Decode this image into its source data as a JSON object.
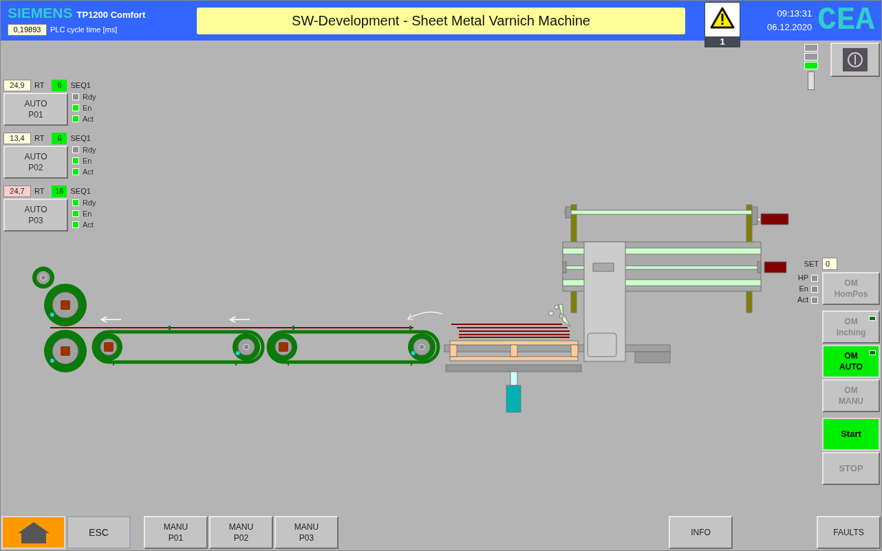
{
  "header": {
    "brand": "SIEMENS",
    "model": "TP1200 Comfort",
    "cycle_value": "0,19893",
    "cycle_label": "PLC cycle time [ms]",
    "title": "SW-Development - Sheet Metal Varnich Machine",
    "alarm_count": "1",
    "time": "09:13:31",
    "date": "06.12.2020",
    "logo": "CEA"
  },
  "status_lamps": [
    {
      "on": false
    },
    {
      "on": false
    },
    {
      "on": true
    }
  ],
  "sequences": [
    {
      "rt_value": "24,9",
      "rt_warning": false,
      "rt_label": "RT",
      "step": "6",
      "seq": "SEQ1",
      "button": [
        "AUTO",
        "P01"
      ],
      "lamps": [
        {
          "label": "Rdy",
          "on": false
        },
        {
          "label": "En",
          "on": true
        },
        {
          "label": "Act",
          "on": true
        }
      ]
    },
    {
      "rt_value": "13,4",
      "rt_warning": false,
      "rt_label": "RT",
      "step": "6",
      "seq": "SEQ1",
      "button": [
        "AUTO",
        "P02"
      ],
      "lamps": [
        {
          "label": "Rdy",
          "on": false
        },
        {
          "label": "En",
          "on": true
        },
        {
          "label": "Act",
          "on": true
        }
      ]
    },
    {
      "rt_value": "24,7",
      "rt_warning": true,
      "rt_label": "RT",
      "step": "16",
      "seq": "SEQ1",
      "button": [
        "AUTO",
        "P03"
      ],
      "lamps": [
        {
          "label": "Rdy",
          "on": true
        },
        {
          "label": "En",
          "on": true
        },
        {
          "label": "Act",
          "on": true
        }
      ]
    }
  ],
  "mode_panel": {
    "set_label": "SET",
    "set_value": "0",
    "homing": {
      "lines": [
        "OM",
        "HomPos"
      ],
      "disabled": true,
      "lamps": [
        {
          "label": "HP",
          "on": false
        },
        {
          "label": "En",
          "on": false
        },
        {
          "label": "Act",
          "on": false
        }
      ]
    },
    "modes": [
      {
        "lines": [
          "OM",
          "Inching"
        ],
        "selected": false,
        "disabled": true,
        "indicator": true
      },
      {
        "lines": [
          "OM",
          "AUTO"
        ],
        "selected": true,
        "disabled": false,
        "indicator": true
      },
      {
        "lines": [
          "OM",
          "MANU"
        ],
        "selected": false,
        "disabled": true,
        "indicator": false
      }
    ],
    "start": {
      "label": "Start",
      "active": true
    },
    "stop": {
      "label": "STOP",
      "disabled": true
    }
  },
  "footer": {
    "left": [
      {
        "kind": "home",
        "selected": true
      },
      {
        "kind": "text",
        "lines": [
          "ESC"
        ],
        "selected": false
      }
    ],
    "manual": [
      {
        "lines": [
          "MANU",
          "P01"
        ]
      },
      {
        "lines": [
          "MANU",
          "P02"
        ]
      },
      {
        "lines": [
          "MANU",
          "P03"
        ]
      }
    ],
    "info": "INFO",
    "faults": "FAULTS"
  }
}
